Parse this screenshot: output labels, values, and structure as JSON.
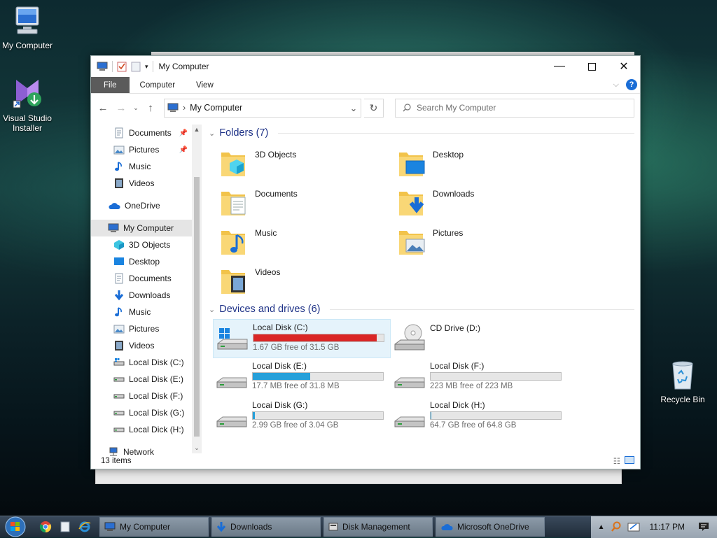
{
  "desktop": {
    "icons": [
      {
        "label": "My Computer",
        "icon": "computer-icon"
      },
      {
        "label": "Visual Studio Installer",
        "icon": "visual-studio-installer-icon"
      },
      {
        "label": "Recycle Bin",
        "icon": "recycle-bin-icon"
      }
    ]
  },
  "window": {
    "title": "My Computer",
    "ribbon_tabs": [
      "File",
      "Computer",
      "View"
    ],
    "address": "My Computer",
    "search_placeholder": "Search My Computer",
    "nav": {
      "quick_access": [
        {
          "label": "Documents",
          "icon": "documents-icon",
          "pinned": true
        },
        {
          "label": "Pictures",
          "icon": "pictures-icon",
          "pinned": true
        },
        {
          "label": "Music",
          "icon": "music-icon",
          "pinned": false
        },
        {
          "label": "Videos",
          "icon": "videos-icon",
          "pinned": false
        }
      ],
      "onedrive": "OneDrive",
      "this_pc": "My Computer",
      "children": [
        {
          "label": "3D Objects",
          "icon": "3d-objects-icon"
        },
        {
          "label": "Desktop",
          "icon": "desktop-icon"
        },
        {
          "label": "Documents",
          "icon": "documents-icon"
        },
        {
          "label": "Downloads",
          "icon": "downloads-icon"
        },
        {
          "label": "Music",
          "icon": "music-icon"
        },
        {
          "label": "Pictures",
          "icon": "pictures-icon"
        },
        {
          "label": "Videos",
          "icon": "videos-icon"
        },
        {
          "label": "Local Disk (C:)",
          "icon": "drive-icon"
        },
        {
          "label": "Local Disk (E:)",
          "icon": "drive-icon"
        },
        {
          "label": "Local Disk (F:)",
          "icon": "drive-icon"
        },
        {
          "label": "Local Disk (G:)",
          "icon": "drive-icon"
        },
        {
          "label": "Local Dick (H:)",
          "icon": "drive-icon"
        }
      ],
      "network": "Network"
    },
    "folders_header": "Folders (7)",
    "folders": [
      {
        "label": "3D Objects",
        "icon": "3d-objects-folder-icon"
      },
      {
        "label": "Desktop",
        "icon": "desktop-folder-icon"
      },
      {
        "label": "Documents",
        "icon": "documents-folder-icon"
      },
      {
        "label": "Downloads",
        "icon": "downloads-folder-icon"
      },
      {
        "label": "Music",
        "icon": "music-folder-icon"
      },
      {
        "label": "Pictures",
        "icon": "pictures-folder-icon"
      },
      {
        "label": "Videos",
        "icon": "videos-folder-icon"
      }
    ],
    "drives_header": "Devices and drives (6)",
    "drives": [
      {
        "label": "Local Disk (C:)",
        "free": "1.67 GB free of 31.5 GB",
        "used_fraction": 0.947,
        "bar_color": "#da2626",
        "system": true
      },
      {
        "label": "CD Drive (D:)",
        "free": "",
        "used_fraction": null,
        "cd": true
      },
      {
        "label": "Local Disk (E:)",
        "free": "17.7 MB free of 31.8 MB",
        "used_fraction": 0.443,
        "bar_color": "#26a0da"
      },
      {
        "label": "Local Disk (F:)",
        "free": "223 MB free of 223 MB",
        "used_fraction": 0.0,
        "bar_color": "#26a0da"
      },
      {
        "label": "Locai Disk (G:)",
        "free": "2.99 GB free of 3.04 GB",
        "used_fraction": 0.016,
        "bar_color": "#26a0da"
      },
      {
        "label": "Local Dick (H:)",
        "free": "64.7 GB free of 64.8 GB",
        "used_fraction": 0.002,
        "bar_color": "#26a0da"
      }
    ],
    "status": "13 items"
  },
  "taskbar": {
    "buttons": [
      {
        "label": "My Computer",
        "icon": "computer-icon"
      },
      {
        "label": "Downloads",
        "icon": "downloads-icon"
      },
      {
        "label": "Disk Management",
        "icon": "disk-management-icon"
      },
      {
        "label": "Microsoft OneDrive",
        "icon": "onedrive-icon"
      }
    ],
    "clock": "11:17 PM"
  }
}
